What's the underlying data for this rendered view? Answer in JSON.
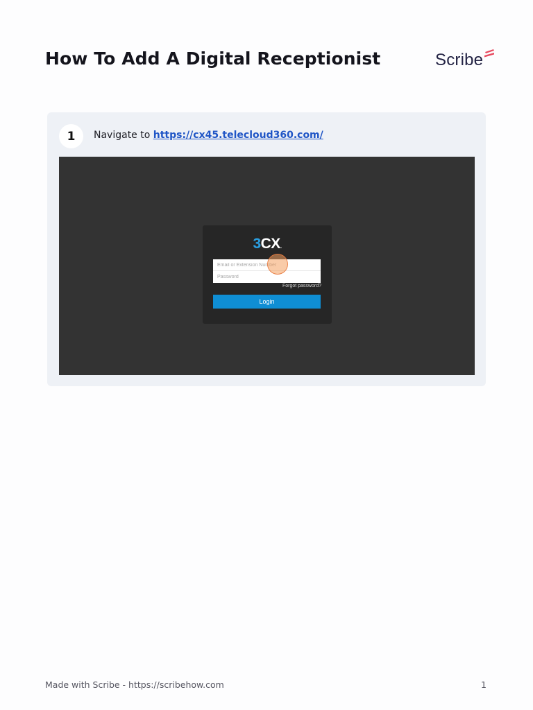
{
  "document": {
    "title": "How To Add A Digital Receptionist"
  },
  "brand": {
    "name": "Scribe",
    "accent_color": "#e84a5f",
    "text_color": "#232344"
  },
  "steps": [
    {
      "number": "1",
      "text_prefix": "Navigate to ",
      "link_text": "https://cx45.telecloud360.com/",
      "screenshot": {
        "logo": {
          "three": "3",
          "cx": "CX",
          "dot": "."
        },
        "email_placeholder": "Email or Extension Number",
        "password_placeholder": "Password",
        "forgot_password": "Forgot password?",
        "login_button": "Login",
        "logo_blue": "#2a9ee0",
        "button_color": "#0f8ed4"
      }
    }
  ],
  "footer": {
    "made_with": "Made with Scribe - https://scribehow.com",
    "page_number": "1"
  }
}
